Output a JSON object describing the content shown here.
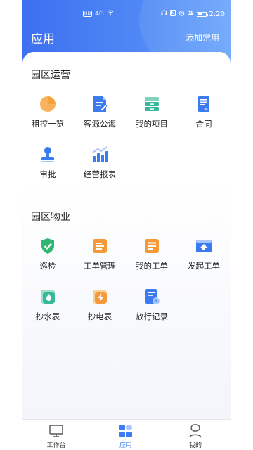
{
  "status_bar": {
    "left_indicators": [
      "HD",
      "4G"
    ],
    "time": "2:20"
  },
  "header": {
    "title": "应用",
    "action": "添加常用"
  },
  "sections": [
    {
      "title": "园区运营",
      "apps": [
        {
          "label": "租控一览",
          "icon": "pie-chart-icon",
          "color": "#f5a03c"
        },
        {
          "label": "客源公海",
          "icon": "document-edit-icon",
          "color": "#3a7bf0"
        },
        {
          "label": "我的项目",
          "icon": "stack-icon",
          "color": "#37b89a"
        },
        {
          "label": "合同",
          "icon": "contract-icon",
          "color": "#3a7bf0"
        },
        {
          "label": "审批",
          "icon": "stamp-icon",
          "color": "#3a7bf0"
        },
        {
          "label": "经营报表",
          "icon": "bar-chart-icon",
          "color": "#3a7bf0"
        }
      ]
    },
    {
      "title": "园区物业",
      "apps": [
        {
          "label": "巡检",
          "icon": "shield-check-icon",
          "color": "#2fb672"
        },
        {
          "label": "工单管理",
          "icon": "work-order-icon",
          "color": "#f59a3b"
        },
        {
          "label": "我的工单",
          "icon": "my-order-icon",
          "color": "#f59a3b"
        },
        {
          "label": "发起工单",
          "icon": "upload-order-icon",
          "color": "#3a7bf0"
        },
        {
          "label": "抄水表",
          "icon": "water-meter-icon",
          "color": "#37b89a"
        },
        {
          "label": "抄电表",
          "icon": "electric-meter-icon",
          "color": "#f59a3b"
        },
        {
          "label": "放行记录",
          "icon": "release-record-icon",
          "color": "#3a7bf0"
        }
      ]
    }
  ],
  "tabbar": [
    {
      "label": "工作台",
      "icon": "monitor-icon",
      "active": false
    },
    {
      "label": "应用",
      "icon": "apps-grid-icon",
      "active": true
    },
    {
      "label": "我的",
      "icon": "person-icon",
      "active": false
    }
  ],
  "colors": {
    "header_gradient_start": "#3d6ff0",
    "header_gradient_end": "#6aa5fb",
    "tab_active": "#3d7cf2"
  }
}
